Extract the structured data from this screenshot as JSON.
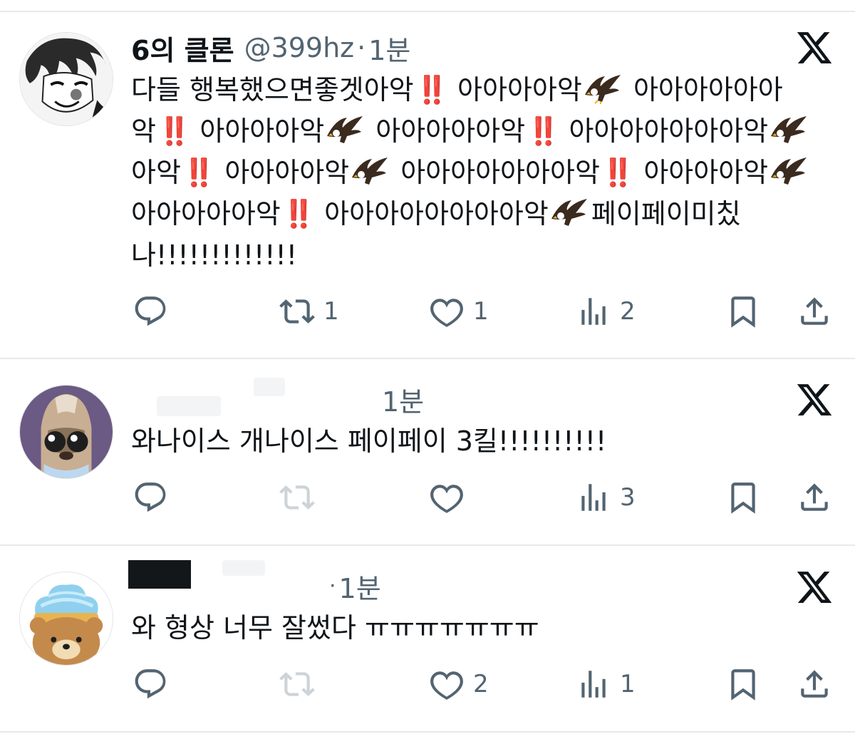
{
  "posts": [
    {
      "author_name": "6의 클론",
      "handle": "@399hz",
      "separator": "·",
      "time": "1분",
      "text_parts": [
        "다들 행복했으면좋겟아악",
        "‼️",
        " 아아아아악",
        "🦅",
        " 아아아아아아악",
        "‼️",
        " 아아아아악",
        "🦅",
        " 아아아아아악",
        "‼️",
        " 아아아아아아아악",
        "🦅",
        " 아악",
        "‼️",
        " 아아아아악",
        "🦅",
        " 아아아아아아아악",
        "‼️",
        " 아아아아악",
        "🦅",
        " 아아아아아악",
        "‼️",
        " 아아아아아아아아악",
        "🦅",
        "페이페이미칬나!!!!!!!!!!!!!"
      ],
      "replies": "",
      "reposts": "1",
      "likes": "1",
      "views": "2"
    },
    {
      "author_name": "",
      "handle": "",
      "separator": "",
      "time": "1분",
      "text_parts": [
        "와나이스 개나이스 페이페이 3킬!!!!!!!!!!"
      ],
      "replies": "",
      "reposts": "",
      "likes": "",
      "views": "3"
    },
    {
      "author_name": "",
      "handle": "",
      "separator": "·",
      "time": "1분",
      "text_parts": [
        "와 형상 너무 잘썼다 ㅠㅠㅠㅠㅠㅠㅠ"
      ],
      "replies": "",
      "reposts": "",
      "likes": "2",
      "views": "1"
    }
  ],
  "icons": {
    "reply": "reply-icon",
    "repost": "repost-icon",
    "like": "heart-icon",
    "views": "views-icon",
    "bookmark": "bookmark-icon",
    "share": "share-icon",
    "platform": "x-logo-icon",
    "eagle": "eagle-emoji",
    "bang": "double-exclamation-emoji"
  },
  "colors": {
    "text": "#0f1419",
    "muted": "#536471",
    "divider": "#e6e9ec",
    "emoji_red": "#e0202f"
  }
}
